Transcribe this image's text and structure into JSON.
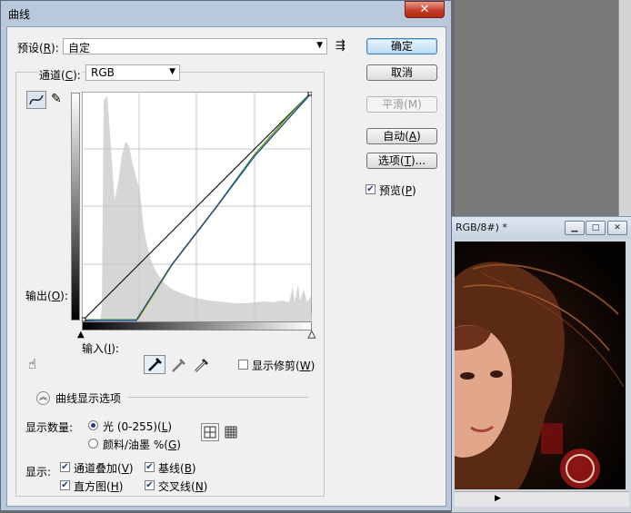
{
  "dialog": {
    "title": "曲线",
    "close_symbol": "✕",
    "preset_label_pre": "预设(",
    "preset_label_key": "R",
    "preset_label_post": "):",
    "preset_value": "自定",
    "channel_label_pre": "通道(",
    "channel_label_key": "C",
    "channel_label_post": "):",
    "channel_value": "RGB",
    "output_label_pre": "输出(",
    "output_label_key": "O",
    "output_label_post": "):",
    "input_label_pre": "输入(",
    "input_label_key": "I",
    "input_label_post": "):",
    "show_clipping_pre": "显示修剪(",
    "show_clipping_key": "W",
    "show_clipping_post": ")",
    "curve_options_label": "曲线显示选项",
    "show_amount_label": "显示数量:",
    "light_pre": "光 (0-255)(",
    "light_key": "L",
    "light_post": ")",
    "pigment_pre": "颜料/油墨 %(",
    "pigment_key": "G",
    "pigment_post": ")",
    "show_label": "显示:",
    "channel_overlay_pre": "通道叠加(",
    "channel_overlay_key": "V",
    "channel_overlay_post": ")",
    "baseline_pre": "基线(",
    "baseline_key": "B",
    "baseline_post": ")",
    "histogram_pre": "直方图(",
    "histogram_key": "H",
    "histogram_post": ")",
    "intersection_pre": "交叉线(",
    "intersection_key": "N",
    "intersection_post": ")",
    "checks": {
      "channel_overlay": true,
      "baseline": true,
      "histogram": true,
      "intersection": true,
      "preview": true,
      "show_clipping": false
    },
    "amount_mode": "light"
  },
  "buttons": {
    "ok": "确定",
    "cancel": "取消",
    "smooth": "平滑(M)",
    "auto_pre": "自动(",
    "auto_key": "A",
    "auto_post": ")",
    "options_pre": "选项(",
    "options_key": "T",
    "options_post": ")...",
    "preview_pre": "预览(",
    "preview_key": "P",
    "preview_post": ")"
  },
  "document": {
    "title": "RGB/8#) *"
  },
  "icons": {
    "curve_tool": "curve-icon",
    "pencil_tool": "pencil-icon",
    "preset_menu": "list-options-icon",
    "hand_tool": "hand-drag-icon",
    "black_eyedropper": "eyedropper-black-icon",
    "gray_eyedropper": "eyedropper-gray-icon",
    "white_eyedropper": "eyedropper-white-icon",
    "simple_grid": "grid-4-icon",
    "detailed_grid": "grid-10-icon",
    "expand": "chevron-up-icon"
  },
  "colors": {
    "curve_blue": "#1e3f9c",
    "curve_green": "#3aa03a",
    "curve_yellow": "#d0c000",
    "histogram": "#d6d6d6",
    "dialog_frame": "#b9c9db"
  }
}
